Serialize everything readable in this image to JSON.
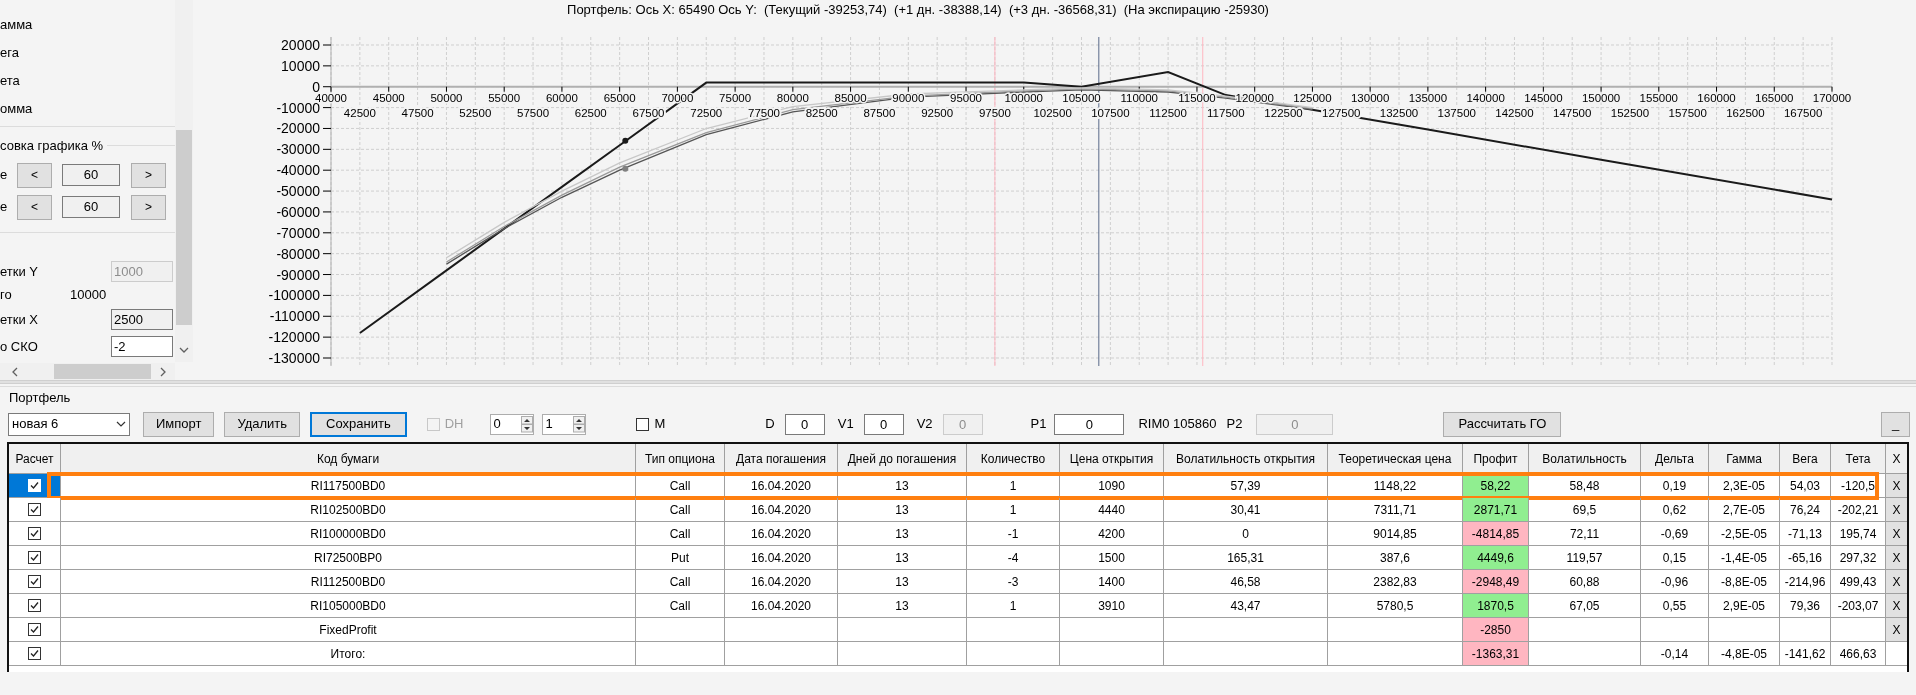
{
  "side_panel": {
    "items": [
      "амма",
      "ега",
      "ета",
      "омма"
    ],
    "group_title": "совка графика %",
    "steppers": [
      {
        "label": "е",
        "dec": "<",
        "value": "60",
        "inc": ">"
      },
      {
        "label": "е",
        "dec": "<",
        "value": "60",
        "inc": ">"
      }
    ],
    "settings": [
      {
        "kind": "field",
        "label": "етки Y",
        "value": "1000",
        "disabled": true
      },
      {
        "kind": "info",
        "label": "го",
        "value": "10000"
      },
      {
        "kind": "field",
        "label": "етки X",
        "value": "2500",
        "disabled": false,
        "readonly": true
      },
      {
        "kind": "field",
        "label": "о СКО",
        "value": "-2",
        "disabled": false,
        "readonly": false
      }
    ]
  },
  "chart": {
    "chart_data": {
      "type": "line",
      "title": "Портфель: Ось X: 65490 Ось Y:  (Текущий -39253,74)  (+1 дн. -38388,14)  (+3 дн. -36568,31)  (На экспирацию -25930)",
      "x": [
        42500,
        50000,
        55000,
        60000,
        65000,
        72500,
        80000,
        90000,
        100000,
        105000,
        112500,
        117500,
        125000,
        135000,
        150000,
        170000
      ],
      "series": [
        {
          "color": "#1a1a1a",
          "values": [
            -118000,
            -88000,
            -68000,
            -48000,
            -28000,
            2000,
            2000,
            2000,
            2000,
            0,
            7000,
            -4000,
            -11000,
            -20500,
            -35000,
            -54000
          ]
        },
        {
          "color": "#555555",
          "values": [
            null,
            -85000,
            -68000,
            -53000,
            -40000,
            -23000,
            -12000,
            -5000,
            -2500,
            -1500,
            -2500,
            -5500,
            -11000,
            null,
            null,
            null
          ]
        },
        {
          "color": "#9a9a9a",
          "values": [
            null,
            -84000,
            -67000,
            -52000,
            -38500,
            -22000,
            -11000,
            -4500,
            -2000,
            -1000,
            -2000,
            -5000,
            -10500,
            null,
            null,
            null
          ]
        },
        {
          "color": "#c8c8c8",
          "values": [
            null,
            -82000,
            -65000,
            -50000,
            -36500,
            -20000,
            -9500,
            -3500,
            -1500,
            -500,
            -1500,
            -4500,
            -10000,
            null,
            null,
            null
          ]
        }
      ],
      "xlim": [
        40000,
        170000
      ],
      "ylim": [
        -130000,
        20000
      ],
      "xticks": [
        40000,
        45000,
        50000,
        55000,
        60000,
        65000,
        70000,
        75000,
        80000,
        85000,
        90000,
        95000,
        100000,
        105000,
        110000,
        115000,
        120000,
        125000,
        130000,
        135000,
        140000,
        145000,
        150000,
        155000,
        160000,
        165000,
        170000
      ],
      "annotations": [
        "42500",
        "47500",
        "52500",
        "57500",
        "62500",
        "67500",
        "72500",
        "77500",
        "82500",
        "87500",
        "92500",
        "97500",
        "102500",
        "107500",
        "112500",
        "117500",
        "122500",
        "127500",
        "132500",
        "137500",
        "142500",
        "147500",
        "152500",
        "157500",
        "162500",
        "167500"
      ],
      "yticks": [
        20000,
        10000,
        0,
        -10000,
        -20000,
        -30000,
        -40000,
        -50000,
        -60000,
        -70000,
        -80000,
        -90000,
        -100000,
        -110000,
        -120000,
        -130000
      ],
      "grid": true,
      "ref_lines": [
        {
          "axis": "x",
          "value": 97500,
          "color": "#ffb6c1"
        },
        {
          "axis": "x",
          "value": 115500,
          "color": "#ffb6c1"
        },
        {
          "axis": "x",
          "value": 106500,
          "color": "#5a6a8a"
        }
      ]
    }
  },
  "portfolio": {
    "title": "Портфель",
    "select": "новая 6",
    "buttons": [
      {
        "label": "Импорт",
        "focused": false
      },
      {
        "label": "Удалить",
        "focused": false
      },
      {
        "label": "Сохранить",
        "focused": true
      }
    ],
    "dh": {
      "label": "DH",
      "checked": false,
      "disabled": true
    },
    "spinners": [
      "0",
      "1"
    ],
    "m": {
      "label": "M",
      "checked": false
    },
    "small_fields": [
      {
        "label": "D",
        "value": "0",
        "disabled": false
      },
      {
        "label": "V1",
        "value": "0",
        "disabled": false
      },
      {
        "label": "V2",
        "value": "0",
        "disabled": true
      }
    ],
    "p1": {
      "label": "P1",
      "value": "0",
      "disabled": false
    },
    "rim": "RIM0 105860",
    "p2": {
      "label": "P2",
      "value": "0",
      "disabled": true
    },
    "calc_button": "Рассчитать ГО",
    "minimize_button": "_"
  },
  "table": {
    "check_column": "Расчет",
    "columns": [
      "Код бумаги",
      "Тип опциона",
      "Дата погашения",
      "Дней до погашения",
      "Количество",
      "Цена открытия",
      "Волатильность открытия",
      "Теоретическая цена",
      "Профит",
      "Волатильность",
      "Дельта",
      "Гамма",
      "Вега",
      "Тета"
    ],
    "remove_column": "X",
    "rows": [
      {
        "checked": true,
        "selected": true,
        "highlighted": true,
        "color": "#90ee90",
        "remove": "X",
        "cells": [
          "RI117500BD0",
          "Call",
          "16.04.2020",
          "13",
          "1",
          "1090",
          "57,39",
          "1148,22",
          "58,22",
          "58,48",
          "0,19",
          "2,3E-05",
          "54,03",
          "-120,5"
        ]
      },
      {
        "checked": true,
        "selected": false,
        "highlighted": false,
        "color": "#90ee90",
        "remove": "X",
        "cells": [
          "RI102500BD0",
          "Call",
          "16.04.2020",
          "13",
          "1",
          "4440",
          "30,41",
          "7311,71",
          "2871,71",
          "69,5",
          "0,62",
          "2,7E-05",
          "76,24",
          "-202,21"
        ]
      },
      {
        "checked": true,
        "selected": false,
        "highlighted": false,
        "color": "#ffb6c1",
        "remove": "X",
        "cells": [
          "RI100000BD0",
          "Call",
          "16.04.2020",
          "13",
          "-1",
          "4200",
          "0",
          "9014,85",
          "-4814,85",
          "72,11",
          "-0,69",
          "-2,5E-05",
          "-71,13",
          "195,74"
        ]
      },
      {
        "checked": true,
        "selected": false,
        "highlighted": false,
        "color": "#90ee90",
        "remove": "X",
        "cells": [
          "RI72500BP0",
          "Put",
          "16.04.2020",
          "13",
          "-4",
          "1500",
          "165,31",
          "387,6",
          "4449,6",
          "119,57",
          "0,15",
          "-1,4E-05",
          "-65,16",
          "297,32"
        ]
      },
      {
        "checked": true,
        "selected": false,
        "highlighted": false,
        "color": "#ffb6c1",
        "remove": "X",
        "cells": [
          "RI112500BD0",
          "Call",
          "16.04.2020",
          "13",
          "-3",
          "1400",
          "46,58",
          "2382,83",
          "-2948,49",
          "60,88",
          "-0,96",
          "-8,8E-05",
          "-214,96",
          "499,43"
        ]
      },
      {
        "checked": true,
        "selected": false,
        "highlighted": false,
        "color": "#90ee90",
        "remove": "X",
        "cells": [
          "RI105000BD0",
          "Call",
          "16.04.2020",
          "13",
          "1",
          "3910",
          "43,47",
          "5780,5",
          "1870,5",
          "67,05",
          "0,55",
          "2,9E-05",
          "79,36",
          "-203,07"
        ]
      },
      {
        "checked": true,
        "selected": false,
        "highlighted": false,
        "color": "#ffb6c1",
        "remove": "X",
        "cells": [
          "FixedProfit",
          null,
          null,
          null,
          null,
          null,
          null,
          null,
          "-2850",
          null,
          null,
          null,
          null,
          null
        ]
      },
      {
        "checked": true,
        "selected": false,
        "highlighted": false,
        "color": "#ffb6c1",
        "cells": [
          "Итого:",
          null,
          null,
          null,
          null,
          null,
          null,
          null,
          "-1363,31",
          null,
          "-0,14",
          "-4,8E-05",
          "-141,62",
          "466,63"
        ]
      }
    ]
  }
}
